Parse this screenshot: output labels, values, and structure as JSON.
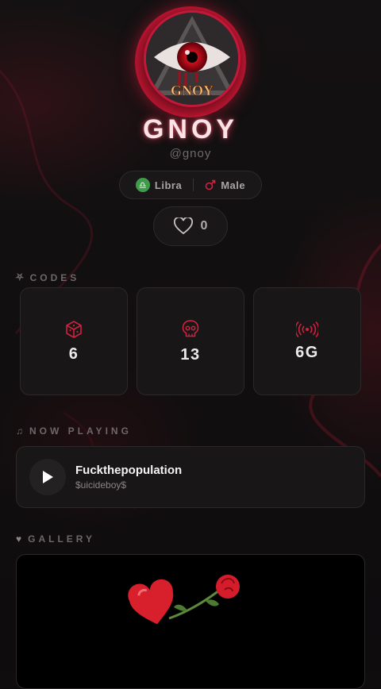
{
  "profile": {
    "display_name": "GNOY",
    "handle": "@gnoy",
    "avatar_text": "GNOY",
    "zodiac": "Libra",
    "gender": "Male",
    "likes": "0"
  },
  "sections": {
    "codes": "CODES",
    "now_playing": "NOW PLAYING",
    "gallery": "GALLERY"
  },
  "codes": [
    {
      "icon": "dice-icon",
      "value": "6"
    },
    {
      "icon": "skull-icon",
      "value": "13"
    },
    {
      "icon": "broadcast-icon",
      "value": "6G"
    }
  ],
  "now_playing": {
    "title": "Fuckthepopulation",
    "artist": "$uicideboy$"
  },
  "colors": {
    "accent": "#d0213f",
    "background": "#0f0d0e",
    "card": "#181617",
    "zodiac_badge": "#3f9a4a"
  }
}
